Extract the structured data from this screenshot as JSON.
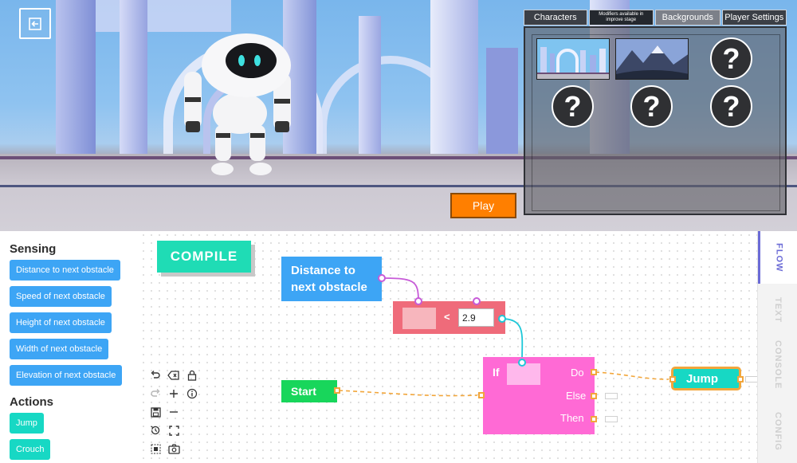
{
  "scene": {
    "exit_icon": "exit-icon",
    "play_label": "Play"
  },
  "panel": {
    "tabs": [
      "Characters",
      "Modifiers available in improve stage",
      "Backgrounds",
      "Player Settings"
    ],
    "locked_glyph": "?"
  },
  "palette": {
    "sensing_heading": "Sensing",
    "sensing": [
      "Distance to next obstacle",
      "Speed of next obstacle",
      "Height of next obstacle",
      "Width of next obstacle",
      "Elevation of next obstacle"
    ],
    "actions_heading": "Actions",
    "actions": [
      "Jump",
      "Crouch"
    ]
  },
  "workspace": {
    "compile_label": "COMPILE",
    "sensor_block": "Distance to next obstacle",
    "compare_operator": "<",
    "compare_value": "2.9",
    "start_block": "Start",
    "if_block": {
      "label": "If",
      "do": "Do",
      "else": "Else",
      "then": "Then"
    },
    "jump_block": "Jump"
  },
  "side_tabs": [
    "FLOW",
    "TEXT",
    "CONSOLE",
    "CONFIG"
  ],
  "colors": {
    "sensing_block": "#3da5f5",
    "action_block": "#17d8c4",
    "compare_block": "#ef6b7a",
    "if_block": "#ff6ad5",
    "start_block": "#18d65b",
    "play_button": "#ff7f00",
    "active_tab": "#6b6bd6"
  }
}
